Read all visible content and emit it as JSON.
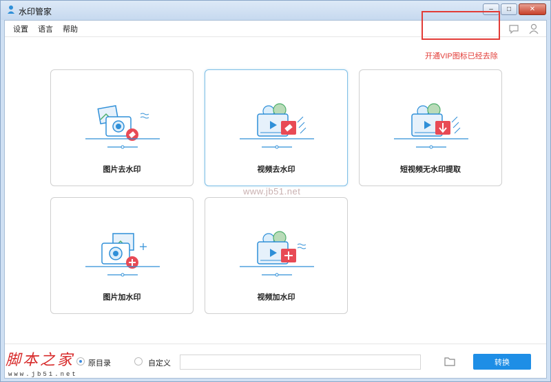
{
  "window": {
    "title": "水印管家"
  },
  "menu": {
    "settings": "设置",
    "language": "语言",
    "help": "帮助"
  },
  "annotation": {
    "vip_note": "开通VIP图标已经去除"
  },
  "cards": [
    {
      "label": "图片去水印"
    },
    {
      "label": "视频去水印"
    },
    {
      "label": "短视频无水印提取"
    },
    {
      "label": "图片加水印"
    },
    {
      "label": "视频加水印"
    }
  ],
  "watermark": {
    "center": "www.jb51.net"
  },
  "bottom": {
    "option_original": "原目录",
    "option_custom": "自定义",
    "path_value": "",
    "convert_label": "转换"
  },
  "site": {
    "logo": "脚本之家",
    "url": "www.jb51.net"
  },
  "colors": {
    "accent": "#1e8ee6",
    "annotation_red": "#e23b36",
    "icon_blue": "#2f8fd8",
    "icon_red": "#e84a55"
  }
}
